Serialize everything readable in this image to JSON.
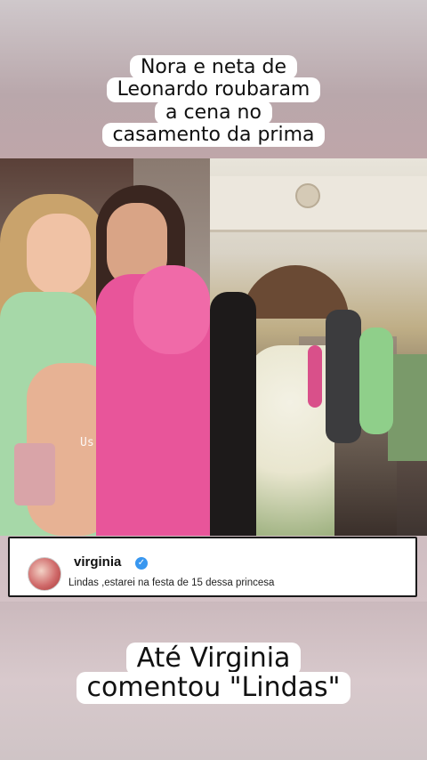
{
  "caption_top": {
    "lines": [
      "Nora e neta de",
      "Leonardo roubaram",
      "a cena no",
      "casamento da prima"
    ]
  },
  "photo_left": {
    "watermark": "Us"
  },
  "comment": {
    "username": "virginia",
    "verified_icon": "verified-badge-icon",
    "text": "Lindas ,estarei na festa de 15 dessa princesa"
  },
  "caption_bottom": {
    "lines": [
      "Até Virginia",
      "comentou \"Lindas\""
    ]
  },
  "colors": {
    "pink_dress": "#e8559a",
    "green_dress": "#a6d8a8",
    "verified_blue": "#3897f0"
  }
}
